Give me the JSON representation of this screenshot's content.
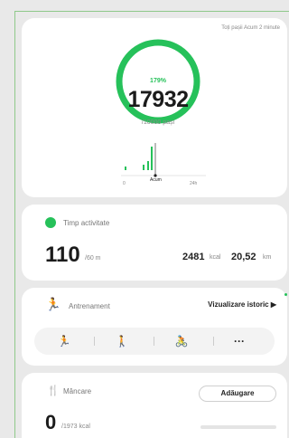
{
  "colors": {
    "accent": "#26c15a",
    "card": "#ffffff",
    "background": "#e9e9e9"
  },
  "steps": {
    "updated": "Toți pașii Acum 2 minute",
    "percent": "179%",
    "value": "17932",
    "goal": "/10000 pași",
    "progress_fraction": 1.0,
    "chart": {
      "labels": [
        "0",
        "Acum",
        "24h"
      ],
      "bars": [
        0.08,
        0.12,
        0.2,
        0.55,
        0.7
      ]
    }
  },
  "activity": {
    "title": "Timp activitate",
    "value": "110",
    "unit": "/60 m",
    "kcal_value": "2481",
    "kcal_unit": "kcal",
    "distance_value": "20,52",
    "distance_unit": "km",
    "icon": "clock-icon"
  },
  "exercise": {
    "title": "Antrenament",
    "history_label": "Vizualizare istoric",
    "history_arrow": "▶",
    "icon": "running-icon",
    "buttons": [
      {
        "name": "run",
        "glyph": "🏃"
      },
      {
        "name": "walk",
        "glyph": "🚶"
      },
      {
        "name": "bike",
        "glyph": "🚴"
      },
      {
        "name": "more",
        "glyph": "···"
      }
    ]
  },
  "food": {
    "title": "Mâncare",
    "add_label": "Adăugare",
    "value": "0",
    "unit": "/1973 kcal",
    "icon": "utensils-icon"
  }
}
